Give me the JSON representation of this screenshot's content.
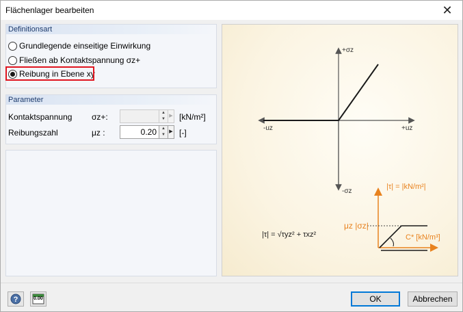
{
  "window": {
    "title": "Flächenlager bearbeiten",
    "close_glyph": "✕"
  },
  "definition": {
    "header": "Definitionsart",
    "options": [
      {
        "label": "Grundlegende einseitige Einwirkung",
        "checked": false
      },
      {
        "label": "Fließen ab Kontaktspannung σz+",
        "checked": false
      },
      {
        "label": "Reibung in Ebene xy",
        "checked": true
      }
    ]
  },
  "parameters": {
    "header": "Parameter",
    "rows": [
      {
        "label": "Kontaktspannung",
        "symbol": "σz+:",
        "value": "",
        "unit": "[kN/m²]",
        "disabled": true
      },
      {
        "label": "Reibungszahl",
        "symbol": "μz :",
        "value": "0.20",
        "unit": "[-]",
        "disabled": false
      }
    ]
  },
  "figure": {
    "axis_top": "+σz",
    "axis_bottom": "-σz",
    "axis_left": "-uz",
    "axis_right": "+uz",
    "tau_label": "|τ| = |kN/m²|",
    "mu_label": "μz |σz|",
    "c_label": "C* [kN/m³]",
    "formula": "|τ| = √τyz² + τxz²",
    "accent_color": "#e8821e",
    "line_color": "#1a1a1a"
  },
  "footer": {
    "help_icon": "help-icon",
    "units_icon": "units-icon",
    "units_text": "0.00",
    "ok_label": "OK",
    "cancel_label": "Abbrechen"
  }
}
